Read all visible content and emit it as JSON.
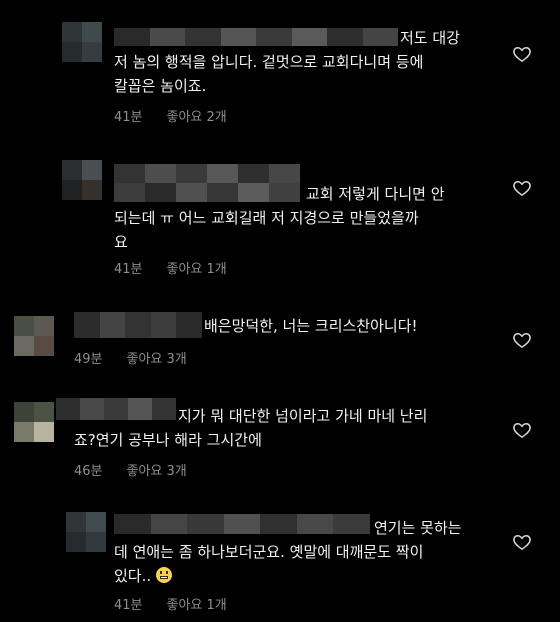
{
  "colors": {
    "background": "#000000",
    "text": "#f2f2f2",
    "meta": "#8e8e8e",
    "heart": "#d8d8d8"
  },
  "comments": [
    {
      "line1": "저도 대강",
      "line2": "저 놈의 행적을 압니다. 겉멋으로 교회다니며 등에",
      "line3": "칼꼽은 놈이죠.",
      "time": "41분",
      "likes": "좋아요 2개",
      "heart_icon": "heart-outline-icon"
    },
    {
      "line1": "교회 저렇게 다니면 안",
      "line2": "되는데 ㅠ 어느 교회길래 저 지경으로 만들었을까",
      "line3": "요",
      "time": "41분",
      "likes": "좋아요 1개",
      "heart_icon": "heart-outline-icon"
    },
    {
      "line1": "배은망덕한, 너는 크리스찬아니다!",
      "time": "49분",
      "likes": "좋아요 3개",
      "heart_icon": "heart-outline-icon"
    },
    {
      "line1": "지가 뭐 대단한 넘이라고 가네 마네 난리",
      "line2": "죠?연기 공부나 해라 그시간에",
      "time": "46분",
      "likes": "좋아요 3개",
      "heart_icon": "heart-outline-icon"
    },
    {
      "line1": "연기는 못하는",
      "line2": "데 연애는 좀 하나보더군요. 옛말에 대깨문도 짝이",
      "line3": "있다..",
      "emoji": "grimacing-face-emoji",
      "time": "41분",
      "likes": "좋아요 1개",
      "heart_icon": "heart-outline-icon"
    }
  ]
}
